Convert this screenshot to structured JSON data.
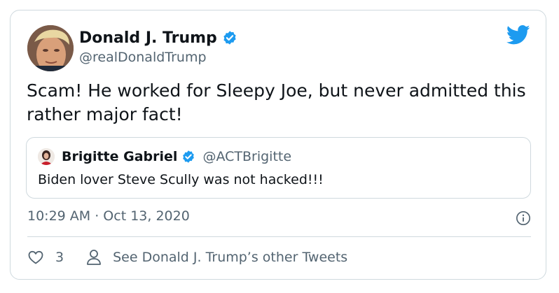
{
  "tweet": {
    "author_name": "Donald J. Trump",
    "author_handle": "@realDonaldTrump",
    "text": "Scam! He worked for Sleepy Joe, but never admitted this rather major fact!",
    "timestamp": "10:29 AM · Oct 13, 2020",
    "like_count": "3",
    "see_more_label": "See Donald J. Trump’s other Tweets"
  },
  "quoted_tweet": {
    "author_name": "Brigitte Gabriel",
    "author_handle": "@ACTBrigitte",
    "text": "Biden lover Steve Scully was not hacked!!!"
  },
  "icons": {
    "verified": "verified-badge-icon",
    "brand": "twitter-bird-icon",
    "info": "info-icon",
    "like": "heart-icon",
    "profile": "person-icon"
  },
  "colors": {
    "brand_blue": "#1d9bf0",
    "text_primary": "#0f1419",
    "text_secondary": "#536471",
    "border": "#cfd9de"
  }
}
